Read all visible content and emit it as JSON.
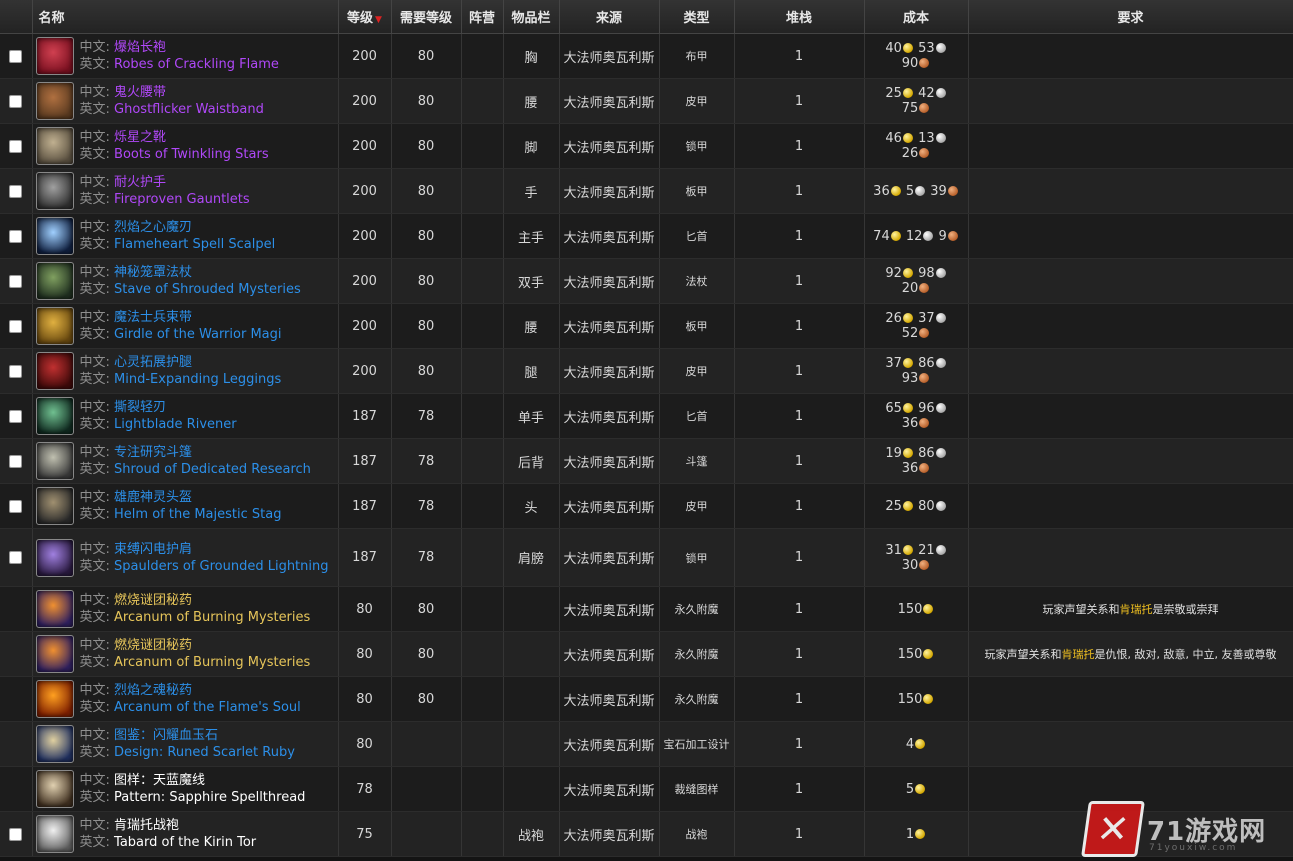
{
  "columns": [
    "名称",
    "等级",
    "需要等级",
    "阵营",
    "物品栏",
    "来源",
    "类型",
    "堆栈",
    "成本",
    "要求"
  ],
  "label_cn": "中文:",
  "label_en": "英文:",
  "rows": [
    {
      "check": true,
      "icon": "robe-icon",
      "icon_colors": [
        "#7a1020",
        "#d04050"
      ],
      "quality": "q-epic",
      "cn": "爆焰长袍",
      "en": "Robes of Crackling Flame",
      "level": "200",
      "req_level": "80",
      "faction": "",
      "slot": "胸",
      "source": "大法师奥瓦利斯",
      "type": "布甲",
      "stack": "1",
      "cost": {
        "line1": [
          [
            "40",
            "gold"
          ],
          [
            "53",
            "silver"
          ]
        ],
        "line2": [
          [
            "90",
            "copper"
          ]
        ]
      },
      "requirement": ""
    },
    {
      "check": true,
      "icon": "belt-icon",
      "icon_colors": [
        "#5a3a20",
        "#b07040"
      ],
      "quality": "q-epic",
      "cn": "鬼火腰带",
      "en": "Ghostflicker Waistband",
      "level": "200",
      "req_level": "80",
      "faction": "",
      "slot": "腰",
      "source": "大法师奥瓦利斯",
      "type": "皮甲",
      "stack": "1",
      "cost": {
        "line1": [
          [
            "25",
            "gold"
          ],
          [
            "42",
            "silver"
          ]
        ],
        "line2": [
          [
            "75",
            "copper"
          ]
        ]
      },
      "requirement": ""
    },
    {
      "check": true,
      "icon": "boots-icon",
      "icon_colors": [
        "#5a5040",
        "#c0b090"
      ],
      "quality": "q-epic",
      "cn": "烁星之靴",
      "en": "Boots of Twinkling Stars",
      "level": "200",
      "req_level": "80",
      "faction": "",
      "slot": "脚",
      "source": "大法师奥瓦利斯",
      "type": "锁甲",
      "stack": "1",
      "cost": {
        "line1": [
          [
            "46",
            "gold"
          ],
          [
            "13",
            "silver"
          ]
        ],
        "line2": [
          [
            "26",
            "copper"
          ]
        ]
      },
      "requirement": ""
    },
    {
      "check": true,
      "icon": "gauntlets-icon",
      "icon_colors": [
        "#303030",
        "#a0a0a0"
      ],
      "quality": "q-epic",
      "cn": "耐火护手",
      "en": "Fireproven Gauntlets",
      "level": "200",
      "req_level": "80",
      "faction": "",
      "slot": "手",
      "source": "大法师奥瓦利斯",
      "type": "板甲",
      "stack": "1",
      "cost": {
        "line1": [
          [
            "36",
            "gold"
          ],
          [
            "5",
            "silver"
          ],
          [
            "39",
            "copper"
          ]
        ],
        "line2": []
      },
      "requirement": ""
    },
    {
      "check": true,
      "icon": "dagger-icon",
      "icon_colors": [
        "#102040",
        "#a0d0ff"
      ],
      "quality": "q-rare",
      "cn": "烈焰之心魔刃",
      "en": "Flameheart Spell Scalpel",
      "level": "200",
      "req_level": "80",
      "faction": "",
      "slot": "主手",
      "source": "大法师奥瓦利斯",
      "type": "匕首",
      "stack": "1",
      "cost": {
        "line1": [
          [
            "74",
            "gold"
          ],
          [
            "12",
            "silver"
          ],
          [
            "9",
            "copper"
          ]
        ],
        "line2": []
      },
      "requirement": ""
    },
    {
      "check": true,
      "icon": "staff-icon",
      "icon_colors": [
        "#203020",
        "#80a060"
      ],
      "quality": "q-rare",
      "cn": "神秘笼罩法杖",
      "en": "Stave of Shrouded Mysteries",
      "level": "200",
      "req_level": "80",
      "faction": "",
      "slot": "双手",
      "source": "大法师奥瓦利斯",
      "type": "法杖",
      "stack": "1",
      "cost": {
        "line1": [
          [
            "92",
            "gold"
          ],
          [
            "98",
            "silver"
          ]
        ],
        "line2": [
          [
            "20",
            "copper"
          ]
        ]
      },
      "requirement": ""
    },
    {
      "check": true,
      "icon": "girdle-icon",
      "icon_colors": [
        "#6a4a10",
        "#e0b040"
      ],
      "quality": "q-rare",
      "cn": "魔法士兵束带",
      "en": "Girdle of the Warrior Magi",
      "level": "200",
      "req_level": "80",
      "faction": "",
      "slot": "腰",
      "source": "大法师奥瓦利斯",
      "type": "板甲",
      "stack": "1",
      "cost": {
        "line1": [
          [
            "26",
            "gold"
          ],
          [
            "37",
            "silver"
          ]
        ],
        "line2": [
          [
            "52",
            "copper"
          ]
        ]
      },
      "requirement": ""
    },
    {
      "check": true,
      "icon": "leggings-icon",
      "icon_colors": [
        "#400a0a",
        "#c03030"
      ],
      "quality": "q-rare",
      "cn": "心灵拓展护腿",
      "en": "Mind-Expanding Leggings",
      "level": "200",
      "req_level": "80",
      "faction": "",
      "slot": "腿",
      "source": "大法师奥瓦利斯",
      "type": "皮甲",
      "stack": "1",
      "cost": {
        "line1": [
          [
            "37",
            "gold"
          ],
          [
            "86",
            "silver"
          ]
        ],
        "line2": [
          [
            "93",
            "copper"
          ]
        ]
      },
      "requirement": ""
    },
    {
      "check": true,
      "icon": "blade-icon",
      "icon_colors": [
        "#102a20",
        "#70c090"
      ],
      "quality": "q-rare",
      "cn": "撕裂轻刃",
      "en": "Lightblade Rivener",
      "level": "187",
      "req_level": "78",
      "faction": "",
      "slot": "单手",
      "source": "大法师奥瓦利斯",
      "type": "匕首",
      "stack": "1",
      "cost": {
        "line1": [
          [
            "65",
            "gold"
          ],
          [
            "96",
            "silver"
          ]
        ],
        "line2": [
          [
            "36",
            "copper"
          ]
        ]
      },
      "requirement": ""
    },
    {
      "check": true,
      "icon": "cloak-icon",
      "icon_colors": [
        "#3a3a3a",
        "#c0c0b0"
      ],
      "quality": "q-rare",
      "cn": "专注研究斗篷",
      "en": "Shroud of Dedicated Research",
      "level": "187",
      "req_level": "78",
      "faction": "",
      "slot": "后背",
      "source": "大法师奥瓦利斯",
      "type": "斗篷",
      "stack": "1",
      "cost": {
        "line1": [
          [
            "19",
            "gold"
          ],
          [
            "86",
            "silver"
          ]
        ],
        "line2": [
          [
            "36",
            "copper"
          ]
        ]
      },
      "requirement": ""
    },
    {
      "check": true,
      "icon": "helm-icon",
      "icon_colors": [
        "#2a2a2a",
        "#a09070"
      ],
      "quality": "q-rare",
      "cn": "雄鹿神灵头盔",
      "en": "Helm of the Majestic Stag",
      "level": "187",
      "req_level": "78",
      "faction": "",
      "slot": "头",
      "source": "大法师奥瓦利斯",
      "type": "皮甲",
      "stack": "1",
      "cost": {
        "line1": [
          [
            "25",
            "gold"
          ],
          [
            "80",
            "silver"
          ]
        ],
        "line2": []
      },
      "requirement": ""
    },
    {
      "check": true,
      "tall": true,
      "icon": "spaulders-icon",
      "icon_colors": [
        "#2a1a40",
        "#a080e0"
      ],
      "quality": "q-rare",
      "cn": "束缚闪电护肩",
      "en": "Spaulders of Grounded Lightning",
      "level": "187",
      "req_level": "78",
      "faction": "",
      "slot": "肩膀",
      "source": "大法师奥瓦利斯",
      "type": "锁甲",
      "stack": "1",
      "cost": {
        "line1": [
          [
            "31",
            "gold"
          ],
          [
            "21",
            "silver"
          ]
        ],
        "line2": [
          [
            "30",
            "copper"
          ]
        ]
      },
      "requirement": ""
    },
    {
      "check": false,
      "icon": "arcanum-icon",
      "icon_colors": [
        "#302060",
        "#f09030"
      ],
      "quality": "q-art",
      "cn": "燃烧谜团秘药",
      "en": "Arcanum of Burning Mysteries",
      "level": "80",
      "req_level": "80",
      "faction": "",
      "slot": "",
      "source": "大法师奥瓦利斯",
      "type": "永久附魔",
      "stack": "1",
      "cost": {
        "line1": [
          [
            "150",
            "gold"
          ]
        ],
        "line2": []
      },
      "requirement": {
        "pre": "玩家声望关系和",
        "hl": "肯瑞托",
        "post": "是崇敬或崇拜"
      }
    },
    {
      "check": false,
      "icon": "arcanum-icon",
      "icon_colors": [
        "#302060",
        "#f09030"
      ],
      "quality": "q-art",
      "cn": "燃烧谜团秘药",
      "en": "Arcanum of Burning Mysteries",
      "level": "80",
      "req_level": "80",
      "faction": "",
      "slot": "",
      "source": "大法师奥瓦利斯",
      "type": "永久附魔",
      "stack": "1",
      "cost": {
        "line1": [
          [
            "150",
            "gold"
          ]
        ],
        "line2": []
      },
      "requirement": {
        "pre": "玩家声望关系和",
        "hl": "肯瑞托",
        "post": "是仇恨, 敌对, 敌意, 中立, 友善或尊敬"
      }
    },
    {
      "check": false,
      "icon": "flame-icon",
      "icon_colors": [
        "#802000",
        "#ffa020"
      ],
      "quality": "q-rare",
      "cn": "烈焰之魂秘药",
      "en": "Arcanum of the Flame's Soul",
      "level": "80",
      "req_level": "80",
      "faction": "",
      "slot": "",
      "source": "大法师奥瓦利斯",
      "type": "永久附魔",
      "stack": "1",
      "cost": {
        "line1": [
          [
            "150",
            "gold"
          ]
        ],
        "line2": []
      },
      "requirement": ""
    },
    {
      "check": false,
      "icon": "scroll-icon",
      "icon_colors": [
        "#203060",
        "#e0d0a0"
      ],
      "quality": "q-rare",
      "cn": "图鉴：闪耀血玉石",
      "en": "Design: Runed Scarlet Ruby",
      "level": "80",
      "req_level": "",
      "faction": "",
      "slot": "",
      "source": "大法师奥瓦利斯",
      "type": "宝石加工设计",
      "stack": "1",
      "cost": {
        "line1": [
          [
            "4",
            "gold"
          ]
        ],
        "line2": []
      },
      "requirement": ""
    },
    {
      "check": false,
      "icon": "pattern-icon",
      "icon_colors": [
        "#403020",
        "#e0d0b0"
      ],
      "quality": "q-white",
      "cn": "图样：天蓝魔线",
      "en": "Pattern: Sapphire Spellthread",
      "level": "78",
      "req_level": "",
      "faction": "",
      "slot": "",
      "source": "大法师奥瓦利斯",
      "type": "裁缝图样",
      "stack": "1",
      "cost": {
        "line1": [
          [
            "5",
            "gold"
          ]
        ],
        "line2": []
      },
      "requirement": ""
    },
    {
      "check": true,
      "icon": "tabard-icon",
      "icon_colors": [
        "#606060",
        "#f0f0f0"
      ],
      "quality": "q-white",
      "cn": "肯瑞托战袍",
      "en": "Tabard of the Kirin Tor",
      "level": "75",
      "req_level": "",
      "faction": "",
      "slot": "战袍",
      "source": "大法师奥瓦利斯",
      "type": "战袍",
      "stack": "1",
      "cost": {
        "line1": [
          [
            "1",
            "gold"
          ]
        ],
        "line2": []
      },
      "requirement": ""
    }
  ],
  "watermark": {
    "text": "71游戏网",
    "sub": "71youxiw.com"
  }
}
